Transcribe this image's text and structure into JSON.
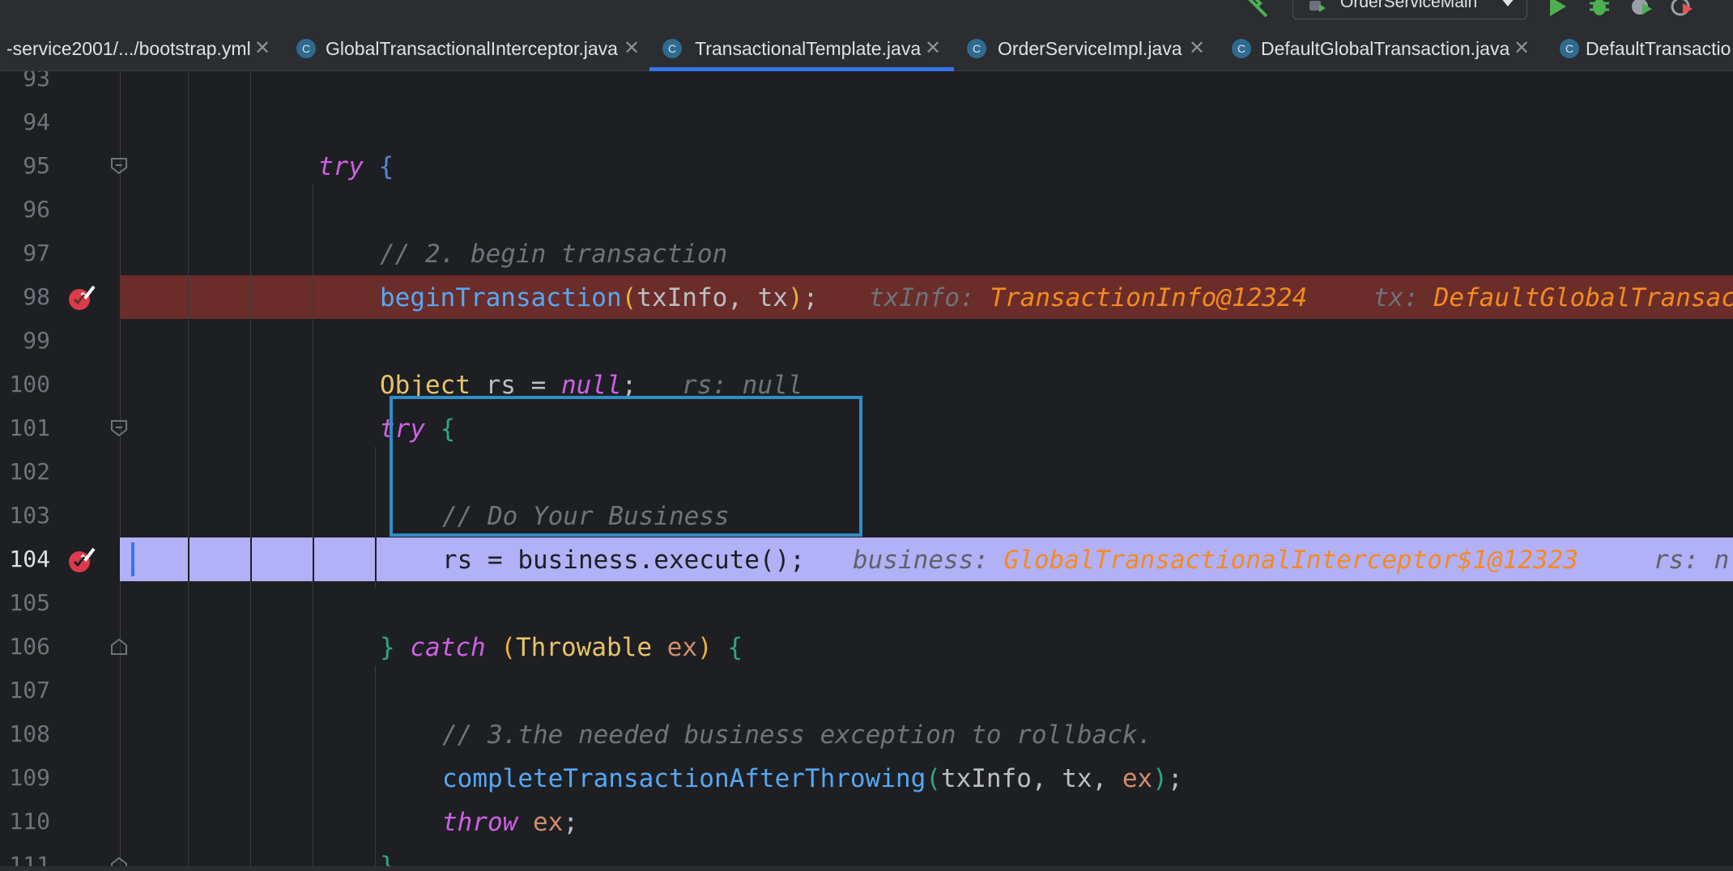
{
  "toolbar": {
    "run_config_label": "OrderServiceMain",
    "icons": [
      "build-hammer-icon",
      "run-config-icon",
      "run-icon",
      "debug-icon",
      "profile-icon",
      "run-with-coverage-icon"
    ]
  },
  "tabs": [
    {
      "label": "-service2001/.../bootstrap.yml",
      "icon": "yaml-file-icon",
      "active": false
    },
    {
      "label": "GlobalTransactionalInterceptor.java",
      "icon": "class-icon",
      "active": false
    },
    {
      "label": "TransactionalTemplate.java",
      "icon": "class-icon",
      "active": true
    },
    {
      "label": "OrderServiceImpl.java",
      "icon": "class-icon",
      "active": false
    },
    {
      "label": "DefaultGlobalTransaction.java",
      "icon": "class-icon",
      "active": false
    },
    {
      "label": "DefaultTransactio",
      "icon": "class-icon",
      "active": false
    }
  ],
  "editor": {
    "line_numbers": [
      "93",
      "94",
      "95",
      "96",
      "97",
      "98",
      "99",
      "100",
      "101",
      "102",
      "103",
      "104",
      "105",
      "106",
      "107",
      "108",
      "109",
      "110",
      "111"
    ],
    "breakpoint_lines": [
      "98",
      "104"
    ],
    "current_execution_line": "104",
    "code": {
      "l95_try": "try",
      "l95_brace": "{",
      "l97_comment": "// 2. begin transaction",
      "l98_fn": "beginTransaction",
      "l98_open": "(",
      "l98_args": "txInfo, tx",
      "l98_close": ")",
      "l98_semi": ";",
      "l98_hint1_key": "txInfo:",
      "l98_hint1_val": "TransactionInfo@12324",
      "l98_hint2_key": "tx:",
      "l98_hint2_val": "DefaultGlobalTransac",
      "l100_type": "Object",
      "l100_decl": " rs = ",
      "l100_null": "null",
      "l100_semi": ";",
      "l100_hint": "rs: null",
      "l101_try": "try",
      "l101_brace": "{",
      "l103_comment": "// Do Your Business",
      "l104_code": "rs = business.execute();",
      "l104_hint1_key": "business:",
      "l104_hint1_val": "GlobalTransactionalInterceptor$1@12323",
      "l104_hint2_key": "rs:",
      "l104_hint2_val": "n",
      "l106_close": "}",
      "l106_catch": "catch",
      "l106_open": "(",
      "l106_type": "Throwable",
      "l106_ex": "ex",
      "l106_close_paren": ")",
      "l106_brace": "{",
      "l108_comment": "// 3.the needed business exception to rollback.",
      "l109_fn": "completeTransactionAfterThrowing",
      "l109_open": "(",
      "l109_args": "txInfo, tx, ",
      "l109_ex": "ex",
      "l109_close": ")",
      "l109_semi": ";",
      "l110_throw": "throw",
      "l110_ex": "ex",
      "l110_semi": ";",
      "l111_brace": "}"
    }
  }
}
